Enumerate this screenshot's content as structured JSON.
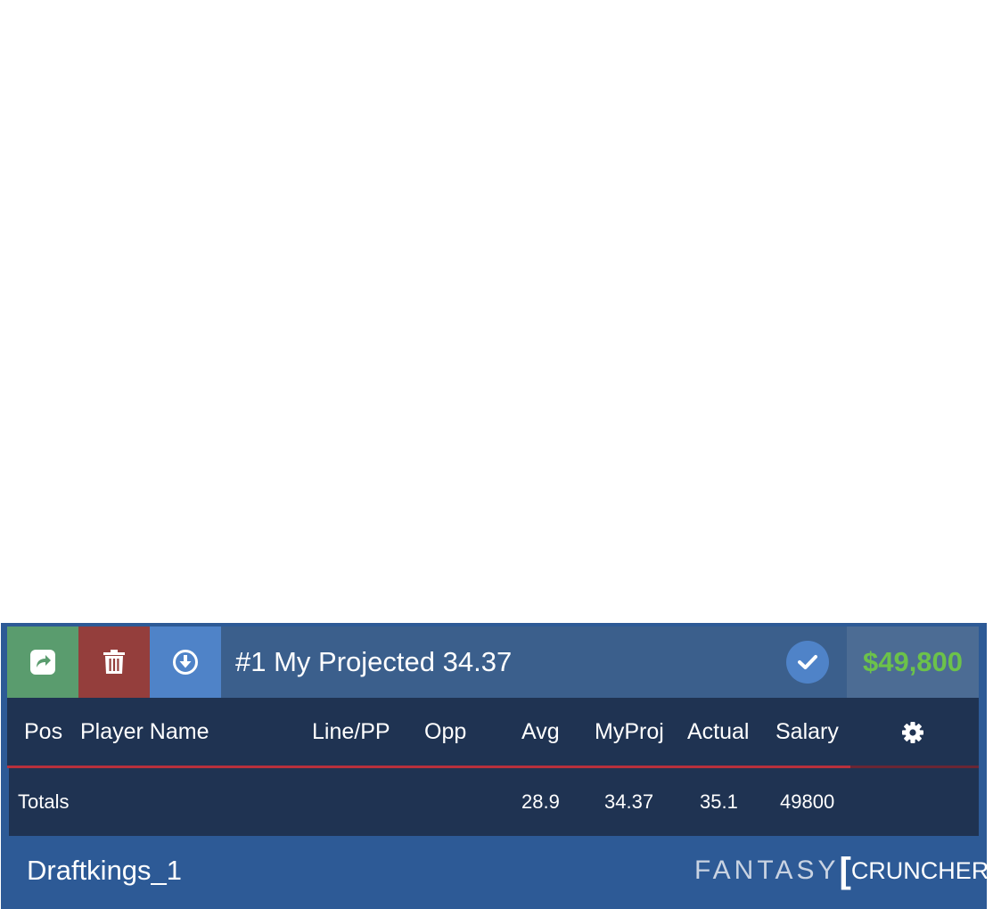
{
  "lineup": {
    "title": "#1 My Projected 34.37",
    "salary_total": "$49,800",
    "salary_color": "#6cc24a"
  },
  "buttons": {
    "share_icon": "share-icon",
    "delete_icon": "trash-icon",
    "download_icon": "download-icon",
    "confirm_icon": "check-icon",
    "settings_icon": "gear-icon"
  },
  "table": {
    "columns": [
      "Pos",
      "Player Name",
      "Line/PP",
      "Opp",
      "Avg",
      "MyProj",
      "Actual",
      "Salary"
    ],
    "totals": {
      "label": "Totals",
      "avg": "28.9",
      "myproj": "34.37",
      "actual": "35.1",
      "salary": "49800"
    }
  },
  "footer": {
    "site_name": "Draftkings_1",
    "logo_left": "FANTASY",
    "logo_open_bracket": "[",
    "logo_right": "CRUNCHER",
    "logo_close_bracket": "]"
  },
  "colors": {
    "share_button": "#5a9c6e",
    "delete_button": "#943e3c",
    "download_button": "#4f83c8",
    "header_bar": "#3b5f8c",
    "table_bg": "#1f3352",
    "panel_bg": "#2d5a96",
    "header_divider": "#b8303c"
  }
}
